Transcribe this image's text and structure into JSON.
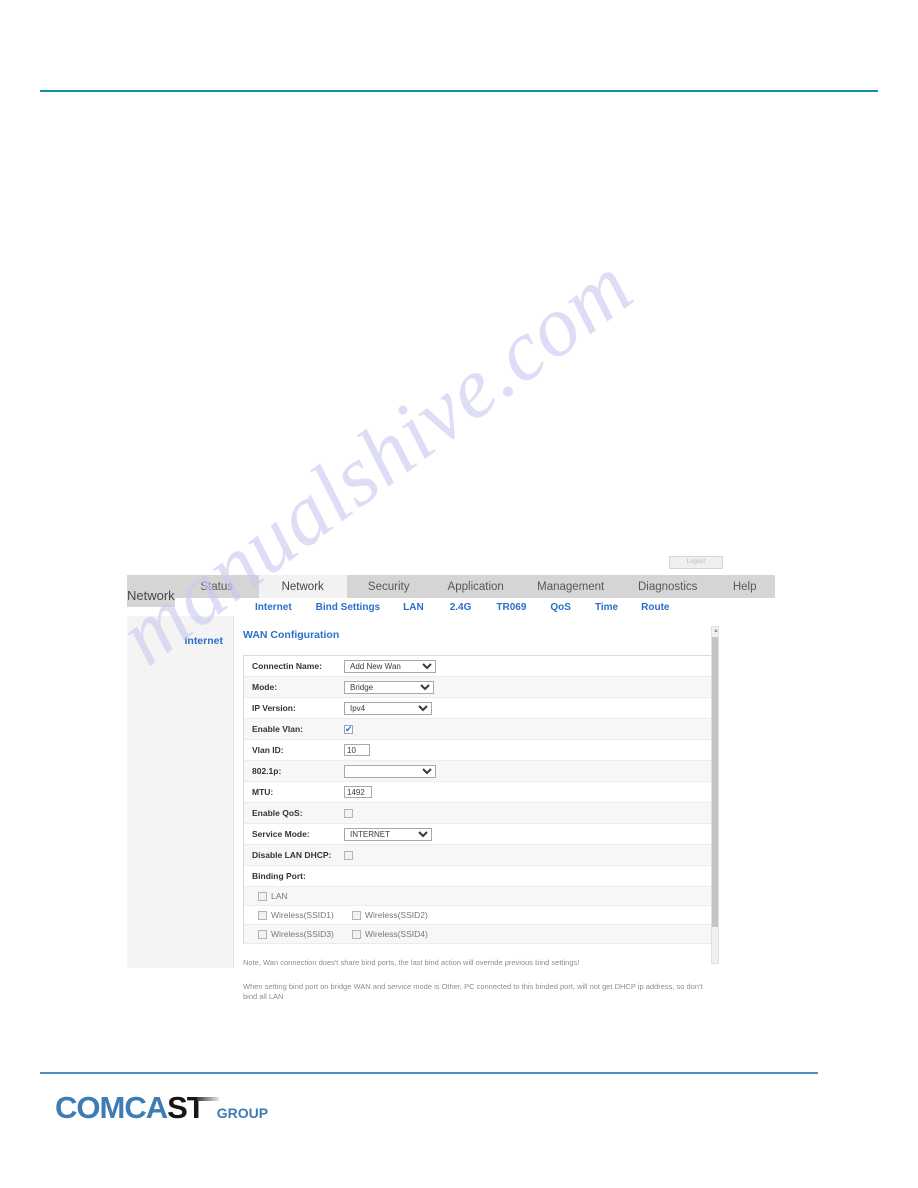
{
  "document": {
    "watermark_text": "manualshive.com",
    "footer_logo": {
      "part1": "COMCA",
      "part2": "ST",
      "part3": "GROUP"
    }
  },
  "router_ui": {
    "logout_label": "Logout",
    "brand": "Network",
    "main_tabs": [
      {
        "label": "Status",
        "active": false
      },
      {
        "label": "Network",
        "active": true
      },
      {
        "label": "Security",
        "active": false
      },
      {
        "label": "Application",
        "active": false
      },
      {
        "label": "Management",
        "active": false
      },
      {
        "label": "Diagnostics",
        "active": false
      },
      {
        "label": "Help",
        "active": false
      }
    ],
    "sub_tabs": [
      {
        "label": "Internet"
      },
      {
        "label": "Bind Settings"
      },
      {
        "label": "LAN"
      },
      {
        "label": "2.4G"
      },
      {
        "label": "TR069"
      },
      {
        "label": "QoS"
      },
      {
        "label": "Time"
      },
      {
        "label": "Route"
      }
    ],
    "sidebar": {
      "items": [
        {
          "label": "Internet"
        }
      ]
    },
    "content": {
      "title": "WAN Configuration",
      "fields": {
        "connection_name": {
          "label": "Connectin Name:",
          "value": "Add New Wan",
          "options": [
            "Add New Wan"
          ]
        },
        "mode": {
          "label": "Mode:",
          "value": "Bridge",
          "options": [
            "Bridge"
          ]
        },
        "ip_version": {
          "label": "IP Version:",
          "value": "Ipv4",
          "options": [
            "Ipv4"
          ]
        },
        "enable_vlan": {
          "label": "Enable Vlan:",
          "checked": true
        },
        "vlan_id": {
          "label": "Vlan ID:",
          "value": "10"
        },
        "dot1p": {
          "label": "802.1p:",
          "value": "",
          "options": [
            ""
          ]
        },
        "mtu": {
          "label": "MTU:",
          "value": "1492"
        },
        "enable_qos": {
          "label": "Enable QoS:",
          "checked": false
        },
        "service_mode": {
          "label": "Service Mode:",
          "value": "INTERNET",
          "options": [
            "INTERNET"
          ]
        },
        "disable_lan_dhcp": {
          "label": "Disable LAN DHCP:",
          "checked": false
        },
        "binding_port": {
          "label": "Binding Port:"
        }
      },
      "binding_ports": [
        {
          "label": "LAN",
          "checked": false
        },
        {
          "label": "Wireless(SSID1)",
          "checked": false
        },
        {
          "label": "Wireless(SSID2)",
          "checked": false
        },
        {
          "label": "Wireless(SSID3)",
          "checked": false
        },
        {
          "label": "Wireless(SSID4)",
          "checked": false
        }
      ],
      "notes": [
        "Note, Wan connection does't share bind ports, the last bind action will override previous bind settings!",
        "When setting bind port on bridge WAN and service mode is Other, PC connected to this binded port, will not get DHCP ip address, so don't bind all LAN"
      ]
    }
  },
  "colors": {
    "top_rule": "#1a8fa3",
    "bottom_rule": "#4d8fc4",
    "link_blue": "#2a6fc9",
    "logo_blue": "#3d7cb5",
    "navbar_gray": "#d5d5d5",
    "watermark": "#c9c9ef"
  }
}
